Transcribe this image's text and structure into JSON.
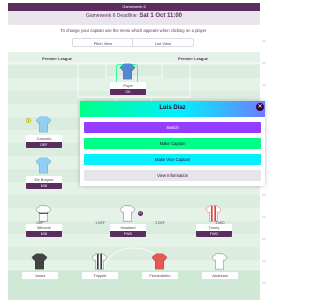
{
  "header": {
    "gameweek_title": "Gameweek 6",
    "deadline_prefix": "Gameweek 6 Deadline:",
    "deadline_value": "Sat 1 Oct 11:00"
  },
  "instructions": "To change your captain use the menu which appears when clicking on a player",
  "view_toggle": {
    "pitch_label": "Pitch View",
    "list_label": "List View"
  },
  "boards": {
    "left": "Premier League",
    "right": "Premier League"
  },
  "players": {
    "gk": {
      "name": "Pope",
      "points": "GK",
      "kit": "#2f6ec9"
    },
    "def": [
      {
        "name": "Cancelo",
        "points": "DEF",
        "kit": "#7cc5ef"
      },
      {
        "name": "Luis Díaz",
        "points": "MID",
        "kit": "#d21a1a"
      },
      {
        "name": "De Bruyne",
        "points": "MID",
        "kit": "#7cc5ef"
      }
    ],
    "mid": [
      {
        "name": "Mitrović",
        "points": "MID",
        "kit": "#ffffff"
      },
      {
        "name": "Haaland",
        "points": "FWD",
        "kit": "#ffffff"
      },
      {
        "name": "Toney",
        "points": "FWD",
        "kit": "#d21a1a"
      }
    ],
    "bench": [
      {
        "name": "Jones",
        "label": "GKP",
        "kit": "#1a1a1a"
      },
      {
        "name": "Trippier",
        "label": "1 DEF",
        "kit": "#e8e8e8"
      },
      {
        "name": "Fenandinho",
        "label": "2 DEF",
        "kit": "#e2322b"
      },
      {
        "name": "Andrews",
        "label": "3 MID",
        "kit": "#ffffff"
      }
    ]
  },
  "modal": {
    "title": "Luis Díaz",
    "close_icon": "close-icon",
    "options": {
      "switch": "Switch",
      "make_captain": "Make Captain",
      "make_vice": "Make Vice Captain",
      "view_info": "View Information"
    }
  },
  "colors": {
    "brand_purple": "#37003c",
    "switch": "#963cff",
    "captain": "#00ff87",
    "vice": "#05f0ff"
  }
}
